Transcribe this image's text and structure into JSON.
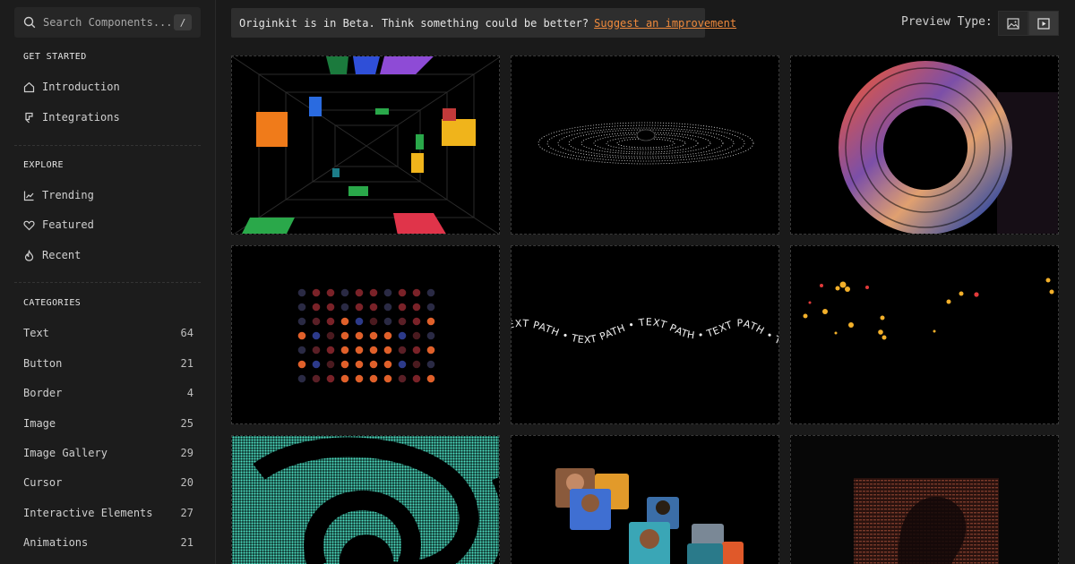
{
  "search": {
    "placeholder": "Search Components...",
    "shortcut": "/"
  },
  "sections": {
    "get_started": {
      "title": "GET STARTED",
      "items": [
        {
          "label": "Introduction",
          "icon": "home-icon"
        },
        {
          "label": "Integrations",
          "icon": "integrations-icon"
        }
      ]
    },
    "explore": {
      "title": "EXPLORE",
      "items": [
        {
          "label": "Trending",
          "icon": "trending-icon"
        },
        {
          "label": "Featured",
          "icon": "heart-icon"
        },
        {
          "label": "Recent",
          "icon": "flame-icon"
        }
      ]
    },
    "categories": {
      "title": "CATEGORIES",
      "items": [
        {
          "label": "Text",
          "count": "64"
        },
        {
          "label": "Button",
          "count": "21"
        },
        {
          "label": "Border",
          "count": "4"
        },
        {
          "label": "Image",
          "count": "25"
        },
        {
          "label": "Image Gallery",
          "count": "29"
        },
        {
          "label": "Cursor",
          "count": "20"
        },
        {
          "label": "Interactive Elements",
          "count": "27"
        },
        {
          "label": "Animations",
          "count": "21"
        }
      ]
    }
  },
  "banner": {
    "text": "Originkit is in Beta. Think something could be better?",
    "link": "Suggest an improvement"
  },
  "preview": {
    "label": "Preview Type:",
    "options": [
      {
        "icon": "image-icon",
        "active": false
      },
      {
        "icon": "video-icon",
        "active": true
      }
    ]
  },
  "cards": [
    {
      "name": "tunnel-card"
    },
    {
      "name": "particle-ring-card"
    },
    {
      "name": "image-donut-card"
    },
    {
      "name": "dot-grid-card"
    },
    {
      "name": "text-path-card",
      "text": "TEXT PATH"
    },
    {
      "name": "floating-emoji-card"
    },
    {
      "name": "spiral-card"
    },
    {
      "name": "avatar-stack-card"
    },
    {
      "name": "ascii-portrait-card"
    }
  ],
  "colors": {
    "accent": "#f08a3c",
    "background": "#1a1a1a",
    "panel": "#2e2e2e"
  }
}
